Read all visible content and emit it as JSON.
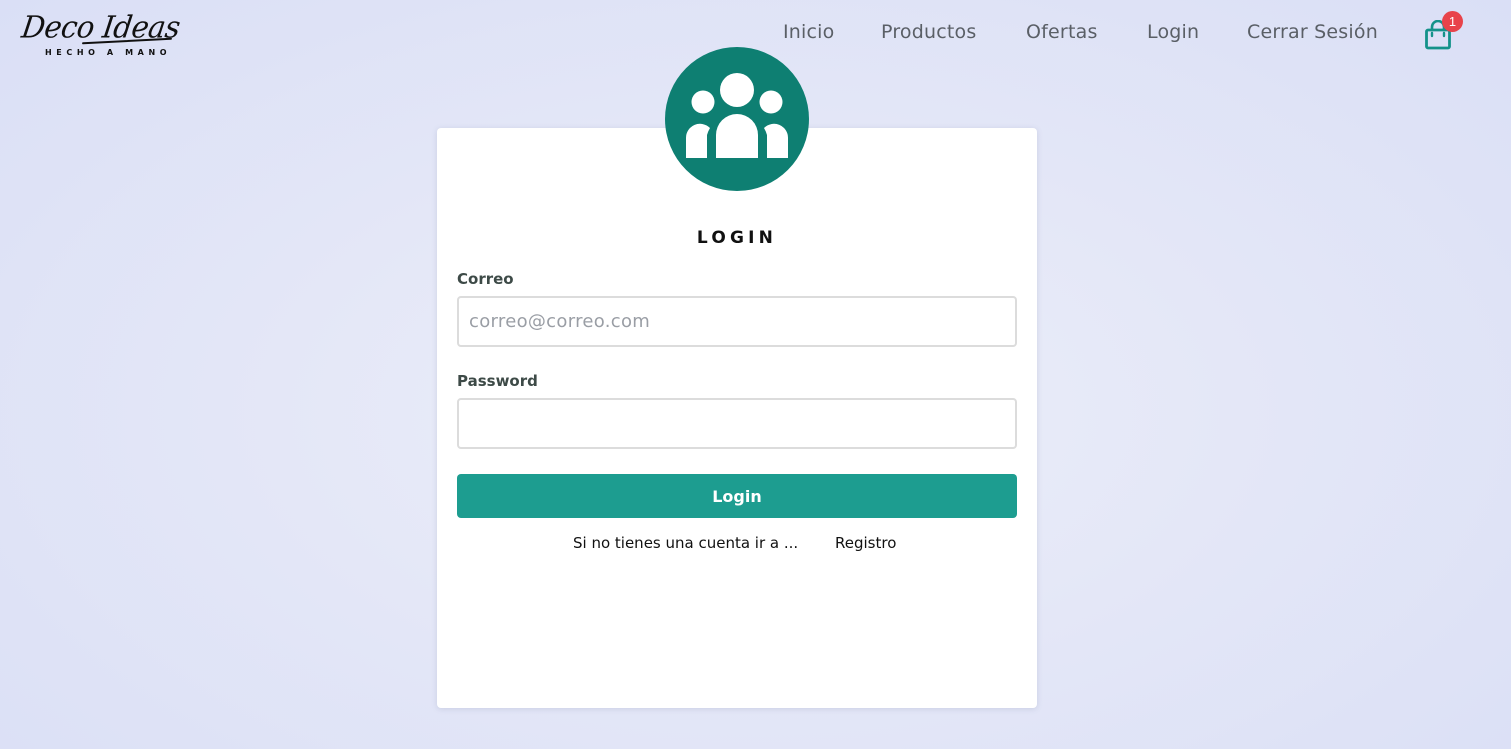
{
  "brand": {
    "name": "Deco Ideas",
    "tagline": "HECHO A MANO"
  },
  "nav": {
    "items": [
      {
        "label": "Inicio"
      },
      {
        "label": "Productos"
      },
      {
        "label": "Ofertas"
      },
      {
        "label": "Login"
      },
      {
        "label": "Cerrar Sesión"
      }
    ],
    "cart": {
      "icon": "shopping-bag-icon",
      "count": "1"
    }
  },
  "login_card": {
    "avatar_icon": "users-group-icon",
    "title": "LOGIN",
    "email": {
      "label": "Correo",
      "placeholder": "correo@correo.com",
      "value": ""
    },
    "password": {
      "label": "Password",
      "placeholder": "",
      "value": ""
    },
    "submit_label": "Login",
    "register_prompt": "Si no tienes una cuenta ir a ...",
    "register_link": "Registro"
  },
  "colors": {
    "primary": "#1d9d90",
    "avatar": "#0e7f72",
    "badge": "#e8434a",
    "cart_icon": "#14928a"
  }
}
